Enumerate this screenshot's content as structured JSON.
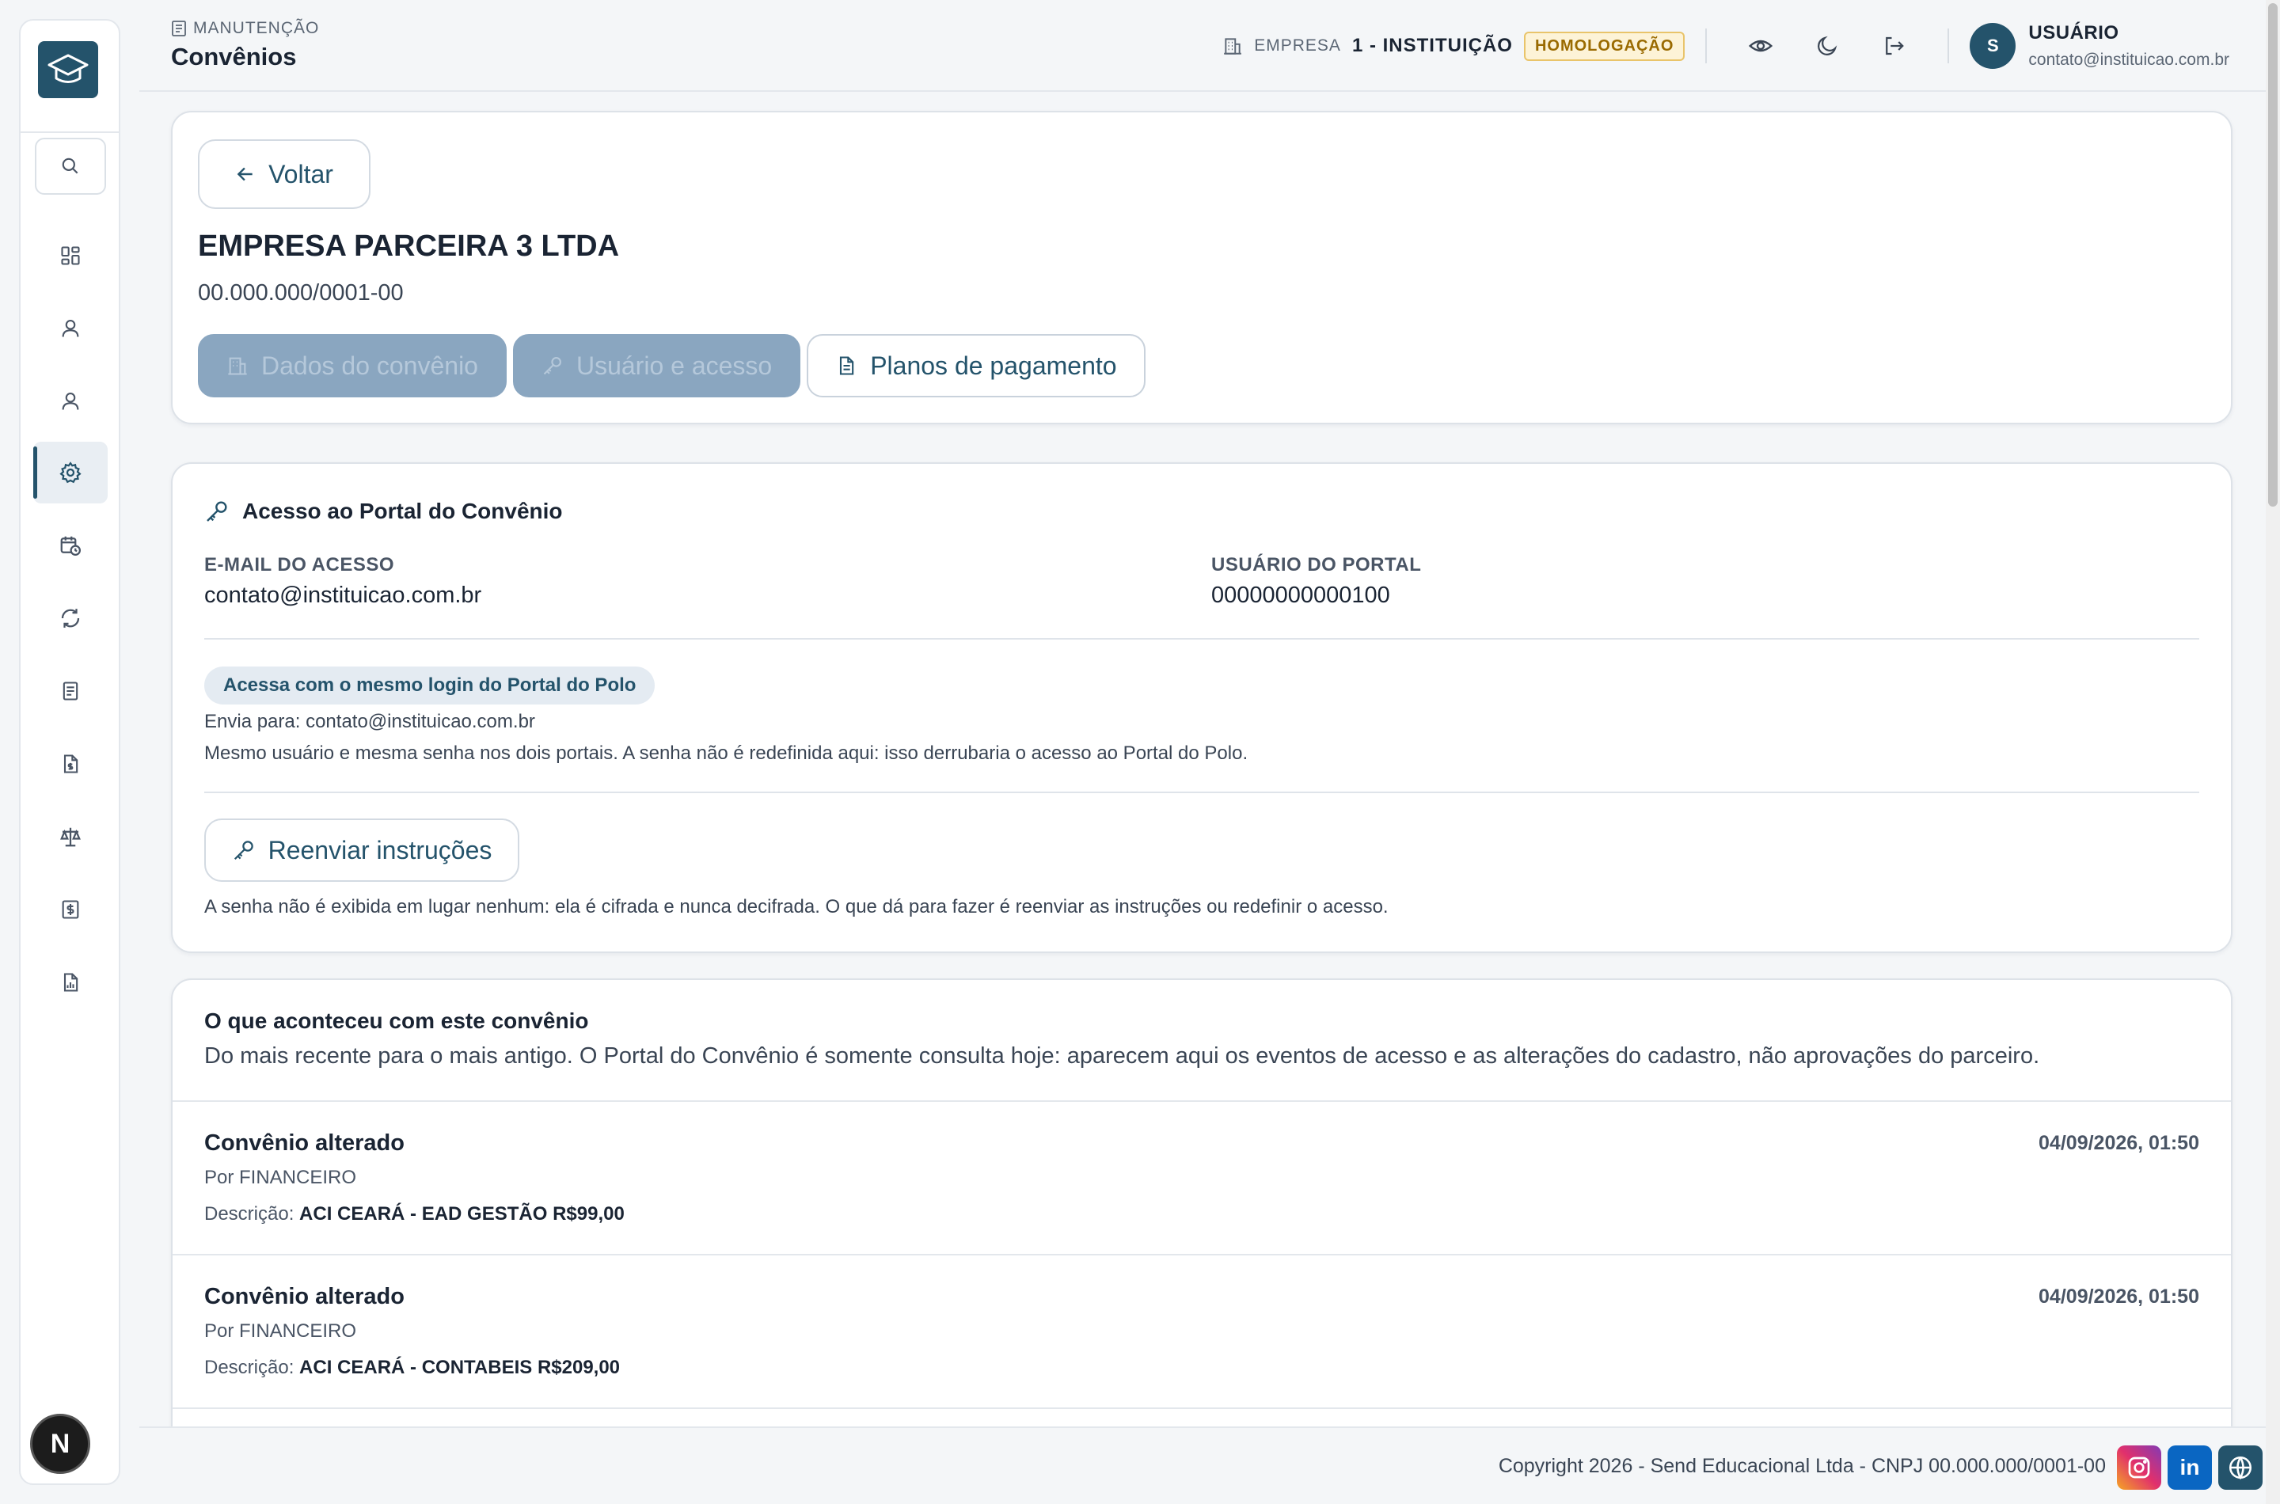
{
  "header": {
    "breadcrumb": "MANUTENÇÃO",
    "title": "Convênios",
    "company_label": "EMPRESA",
    "company_name": "1 - INSTITUIÇÃO",
    "environment_badge": "HOMOLOGAÇÃO",
    "user_initial": "S",
    "user_name": "USUÁRIO",
    "user_email": "contato@instituicao.com.br"
  },
  "sidebar": {
    "items": [
      {
        "icon": "dashboard-icon"
      },
      {
        "icon": "user-icon"
      },
      {
        "icon": "user-alt-icon"
      },
      {
        "icon": "settings-icon",
        "active": true
      },
      {
        "icon": "calendar-clock-icon"
      },
      {
        "icon": "refresh-icon"
      },
      {
        "icon": "document-list-icon"
      },
      {
        "icon": "file-money-icon"
      },
      {
        "icon": "scale-icon"
      },
      {
        "icon": "dollar-receipt-icon"
      },
      {
        "icon": "report-chart-icon"
      }
    ],
    "bottom_avatar": "N"
  },
  "agreement": {
    "back_label": "Voltar",
    "company_name": "EMPRESA PARCEIRA 3 LTDA",
    "cnpj": "00.000.000/0001-00",
    "tabs": [
      {
        "label": "Dados do convênio",
        "state": "disabled"
      },
      {
        "label": "Usuário e acesso",
        "state": "disabled"
      },
      {
        "label": "Planos de pagamento",
        "state": "active"
      }
    ]
  },
  "access": {
    "title": "Acesso ao Portal do Convênio",
    "email_label": "E-MAIL DO ACESSO",
    "email_value": "contato@instituicao.com.br",
    "user_label": "USUÁRIO DO PORTAL",
    "user_value": "00000000000100",
    "same_login_pill": "Acessa com o mesmo login do Portal do Polo",
    "sends_to": "Envia para: contato@instituicao.com.br",
    "same_login_note": "Mesmo usuário e mesma senha nos dois portais. A senha não é redefinida aqui: isso derrubaria o acesso ao Portal do Polo.",
    "resend_label": "Reenviar instruções",
    "password_note": "A senha não é exibida em lugar nenhum: ela é cifrada e nunca decifrada. O que dá para fazer é reenviar as instruções ou redefinir o acesso."
  },
  "history": {
    "title": "O que aconteceu com este convênio",
    "subtitle": "Do mais recente para o mais antigo. O Portal do Convênio é somente consulta hoje: aparecem aqui os eventos de acesso e as alterações do cadastro, não aprovações do parceiro.",
    "description_prefix": "Descrição:",
    "events": [
      {
        "title": "Convênio alterado",
        "date": "04/09/2026, 01:50",
        "by": "Por FINANCEIRO",
        "description": "ACI CEARÁ - EAD GESTÃO R$99,00"
      },
      {
        "title": "Convênio alterado",
        "date": "04/09/2026, 01:50",
        "by": "Por FINANCEIRO",
        "description": "ACI CEARÁ - CONTABEIS R$209,00"
      }
    ]
  },
  "footer": {
    "copyright": "Copyright 2026 - Send Educacional Ltda - CNPJ 00.000.000/0001-00",
    "linkedin_label": "in"
  },
  "colors": {
    "brand": "#24536b",
    "badge_bg": "#fdf3d7",
    "badge_text": "#9a6a00",
    "tab_disabled": "#8aa6c0"
  }
}
